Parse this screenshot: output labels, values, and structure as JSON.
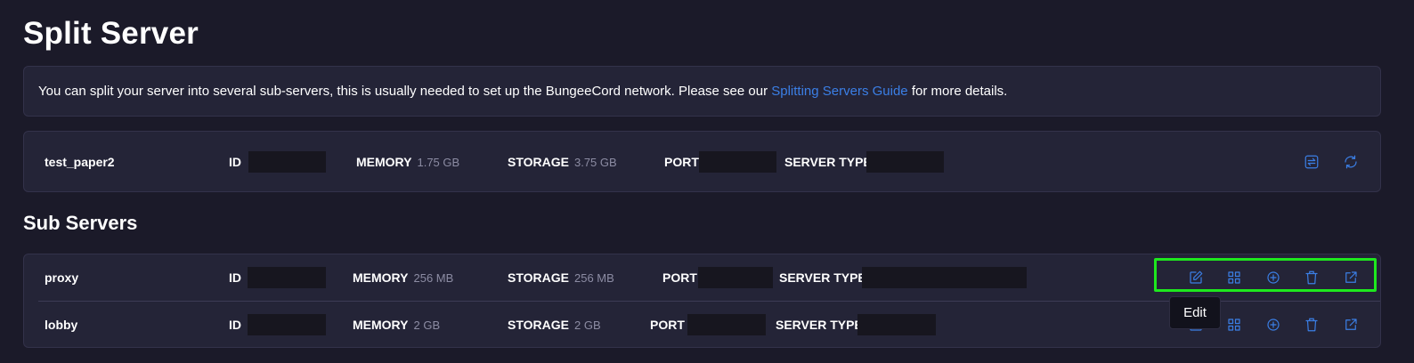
{
  "page": {
    "title": "Split Server",
    "info_text": "You can split your server into several sub-servers, this is usually needed to set up the BungeeCord network. Please see our",
    "info_link": "Splitting Servers Guide",
    "info_suffix": "for more details."
  },
  "main_server": {
    "name": "test_paper2",
    "id_label": "ID",
    "memory_label": "MEMORY",
    "memory_value": "1.75 GB",
    "storage_label": "STORAGE",
    "storage_value": "3.75 GB",
    "port_label": "PORT",
    "type_label": "SERVER TYPE",
    "actions": [
      "swap-icon",
      "refresh-icon"
    ]
  },
  "sub_servers_title": "Sub Servers",
  "sub_servers": [
    {
      "name": "proxy",
      "id_label": "ID",
      "memory_label": "MEMORY",
      "memory_value": "256 MB",
      "storage_label": "STORAGE",
      "storage_value": "256 MB",
      "port_label": "PORT",
      "type_label": "SERVER TYPE"
    },
    {
      "name": "lobby",
      "id_label": "ID",
      "memory_label": "MEMORY",
      "memory_value": "2 GB",
      "storage_label": "STORAGE",
      "storage_value": "2 GB",
      "port_label": "PORT",
      "type_label": "SERVER TYPE"
    }
  ],
  "sub_actions": [
    "edit-icon",
    "grid-icon",
    "add-circle-icon",
    "trash-icon",
    "external-link-icon"
  ],
  "tooltip": "Edit",
  "colors": {
    "background": "#1b1a29",
    "card": "#242437",
    "accent": "#3b7fe6",
    "highlight": "#1ee81e"
  }
}
